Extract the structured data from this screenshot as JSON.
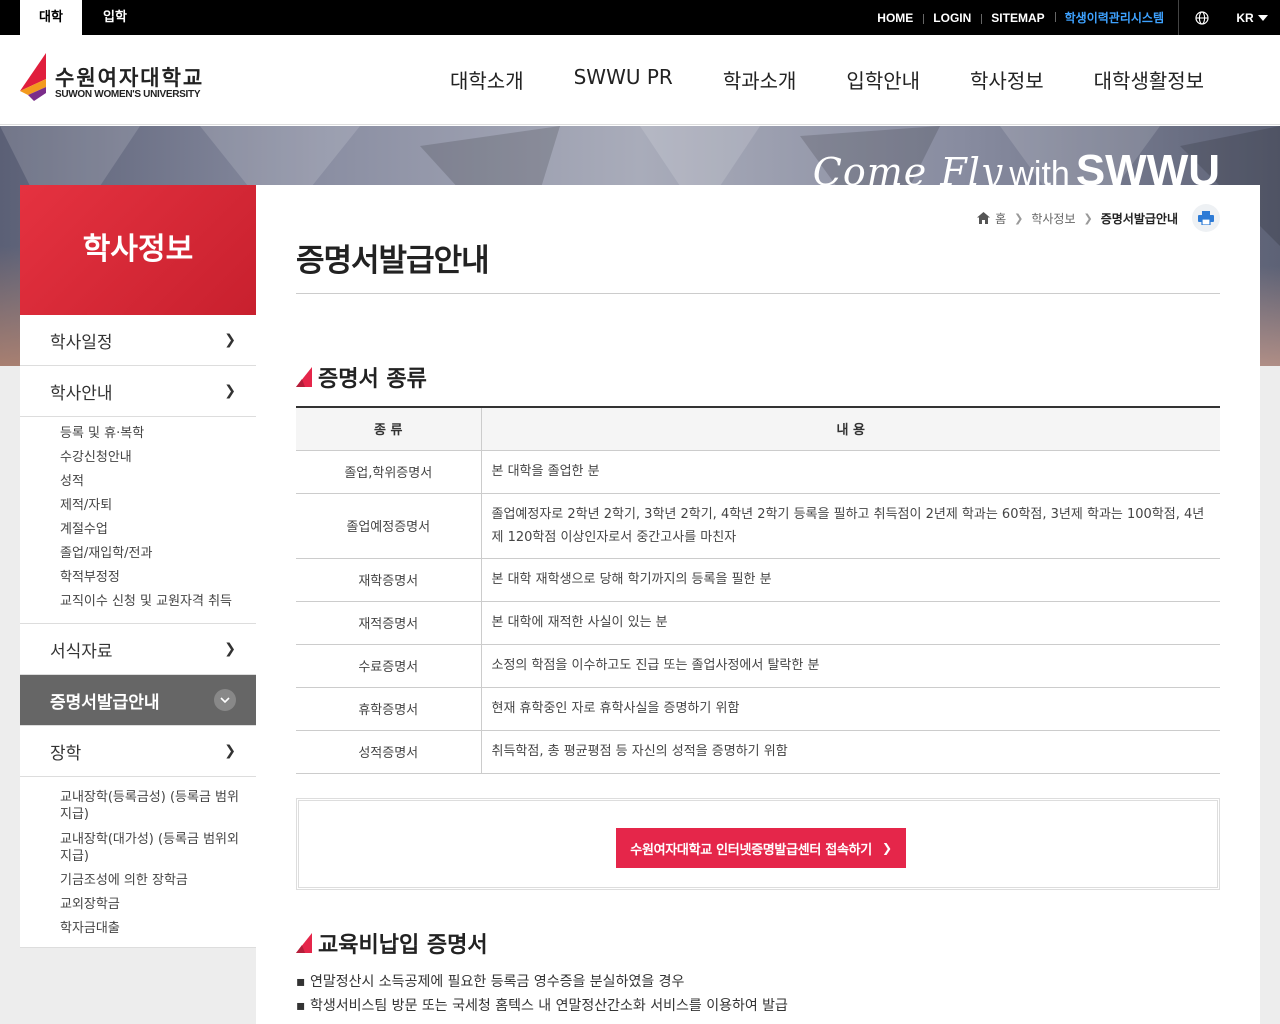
{
  "topbar": {
    "tabs": [
      "대학",
      "입학"
    ],
    "links": [
      "HOME",
      "LOGIN",
      "SITEMAP",
      "학생이력관리시스템"
    ],
    "lang": "KR"
  },
  "header": {
    "logo_kr": "수원여자대학교",
    "logo_en": "SUWON WOMEN'S UNIVERSITY",
    "nav": [
      "대학소개",
      "SWWU PR",
      "학과소개",
      "입학안내",
      "학사정보",
      "대학생활정보"
    ]
  },
  "banner": {
    "slogan_script": "Come Fly",
    "slogan_with": "with",
    "slogan_brand": "SWWU"
  },
  "sidebar": {
    "title": "학사정보",
    "menu": [
      {
        "label": "학사일정"
      },
      {
        "label": "학사안내",
        "sub": [
          "등록 및 휴·복학",
          "수강신청안내",
          "성적",
          "제적/자퇴",
          "계절수업",
          "졸업/재입학/전과",
          "학적부정정",
          "교직이수 신청 및 교원자격 취득"
        ]
      },
      {
        "label": "서식자료"
      },
      {
        "label": "증명서발급안내"
      },
      {
        "label": "장학",
        "sub": [
          "교내장학(등록금성) (등록금 범위 지급)",
          "교내장학(대가성) (등록금 범위외 지급)",
          "기금조성에 의한 장학금",
          "교외장학금",
          "학자금대출"
        ]
      }
    ]
  },
  "breadcrumb": {
    "home": "홈",
    "items": [
      "학사정보",
      "증명서발급안내"
    ]
  },
  "page": {
    "title": "증명서발급안내",
    "section1": "증명서 종류",
    "section2": "교육비납입 증명서"
  },
  "cert_table": {
    "headers": [
      "종 류",
      "내 용"
    ],
    "rows": [
      {
        "type": "졸업,학위증명서",
        "desc": "본 대학을 졸업한 분"
      },
      {
        "type": "졸업예정증명서",
        "desc": "졸업예정자로 2학년 2학기, 3학년 2학기, 4학년 2학기 등록을 필하고 취득점이 2년제 학과는 60학점, 3년제 학과는 100학점, 4년제 120학점 이상인자로서 중간고사를 마친자"
      },
      {
        "type": "재학증명서",
        "desc": "본 대학 재학생으로 당해 학기까지의 등록을 필한 분"
      },
      {
        "type": "재적증명서",
        "desc": "본 대학에 재적한 사실이 있는 분"
      },
      {
        "type": "수료증명서",
        "desc": "소정의 학점을 이수하고도 진급 또는 졸업사정에서 탈락한 분"
      },
      {
        "type": "휴학증명서",
        "desc": "현재 휴학중인 자로 휴학사실을 증명하기 위함"
      },
      {
        "type": "성적증명서",
        "desc": "취득학점, 총 평균평점 등 자신의 성적을 증명하기 위함"
      }
    ]
  },
  "link_button": "수원여자대학교 인터넷증명발급센터 접속하기",
  "bullets": [
    "연말정산시 소득공제에 필요한 등록금 영수증을 분실하였을 경우",
    "학생서비스팀 방문 또는 국세청 홈텍스 내 연말정산간소화 서비스를 이용하여 발급"
  ],
  "colors": {
    "accent_red": "#e5264a",
    "sidebar_title": "#d42a36",
    "active_menu": "#666666",
    "system_link": "#3ea2ff"
  }
}
